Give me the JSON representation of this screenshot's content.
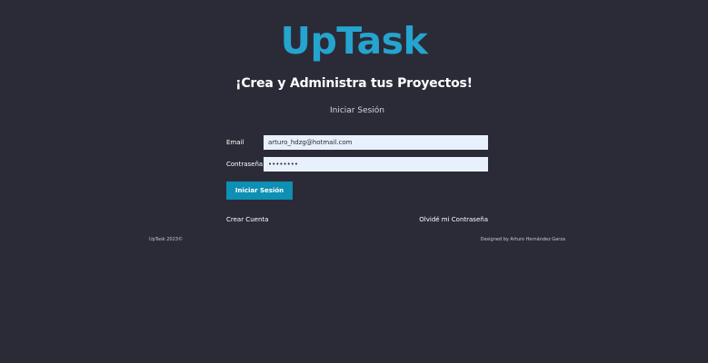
{
  "app": {
    "logo": "UpTask"
  },
  "header": {
    "tagline": "¡Crea y Administra tus Proyectos!",
    "subtitle": "Iniciar Sesión"
  },
  "form": {
    "email_label": "Email",
    "email_value": "arturo_hdzg@hotmail.com",
    "password_label": "Contraseña",
    "password_value": "••••••••",
    "submit_label": "Iniciar Sesión"
  },
  "links": {
    "create_account": "Crear Cuenta",
    "forgot_password": "Olvidé mi Contraseña"
  },
  "footer": {
    "copyright": "UpTask 2023©",
    "credits": "Designed by Arturo Hernández Garza"
  },
  "colors": {
    "background": "#2b2b38",
    "brand": "#25a4cf",
    "button": "#0e8fb4",
    "input_bg": "#e8f0fe"
  }
}
